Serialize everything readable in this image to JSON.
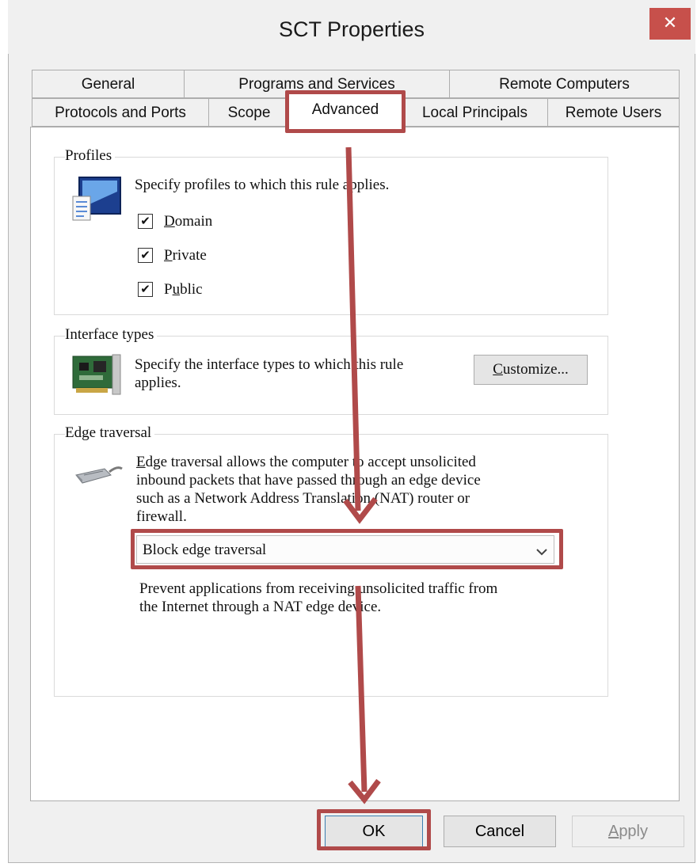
{
  "window": {
    "title": "SCT Properties",
    "close_glyph": "✕"
  },
  "tabs": {
    "row1": [
      "General",
      "Programs and Services",
      "Remote Computers"
    ],
    "row2": [
      "Protocols and Ports",
      "Scope",
      "Advanced",
      "Local Principals",
      "Remote Users"
    ],
    "active": "Advanced"
  },
  "profiles": {
    "group_label": "Profiles",
    "description": "Specify profiles to which this rule applies.",
    "icon": "profile-monitor-icon",
    "options": [
      {
        "label_first": "D",
        "label_rest": "omain",
        "checked": true
      },
      {
        "label_first": "P",
        "label_rest": "rivate",
        "checked": true
      },
      {
        "label_pre": "P",
        "label_first": "u",
        "label_rest": "blic",
        "checked": true
      }
    ]
  },
  "interface_types": {
    "group_label": "Interface types",
    "description_line1": "Specify the interface types to which this rule",
    "description_line2": "applies.",
    "icon": "network-card-icon",
    "customize_first": "C",
    "customize_rest": "ustomize..."
  },
  "edge_traversal": {
    "group_label": "Edge traversal",
    "icon": "network-cable-icon",
    "description_first": "E",
    "description_line1_rest": "dge traversal allows the computer to accept unsolicited",
    "description_line2": "inbound packets that have passed through an edge device",
    "description_line3": "such as a Network Address Translation (NAT) router or",
    "description_line4": "firewall.",
    "selected": "Block edge traversal",
    "help_line1": "Prevent applications from receiving unsolicited traffic from",
    "help_line2": "the Internet through a NAT edge device."
  },
  "buttons": {
    "ok": "OK",
    "cancel": "Cancel",
    "apply_first": "A",
    "apply_rest": "pply"
  },
  "annotation_color": "#b04a4a"
}
